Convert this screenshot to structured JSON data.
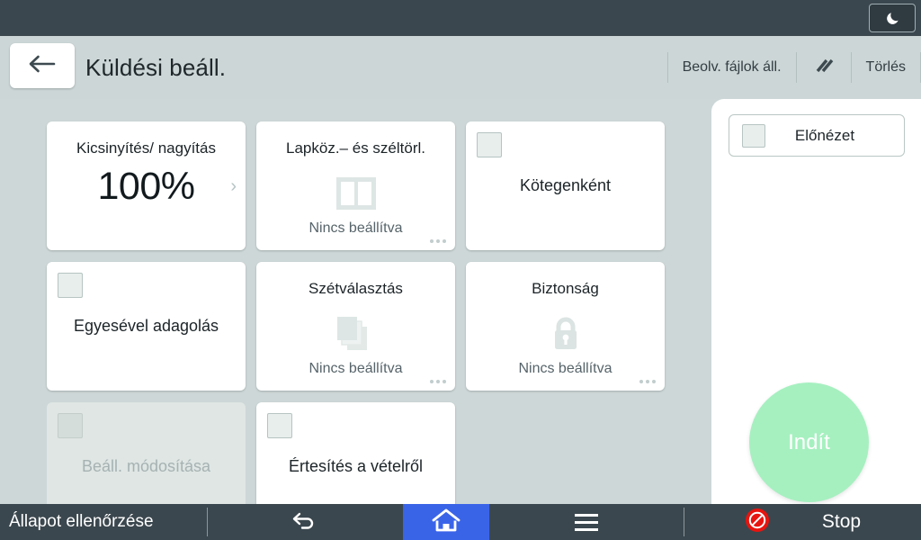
{
  "topbar": {
    "night_mode_icon": "moon-icon"
  },
  "header": {
    "back_icon": "arrow-left-icon",
    "title": "Küldési beáll.",
    "scanned_files_label": "Beolv. fájlok áll.",
    "slash_icon": "double-slash-icon",
    "clear_label": "Törlés"
  },
  "cards": [
    {
      "id": "reduce-enlarge",
      "title": "Kicsinyítés/ nagyítás",
      "value": "100%",
      "chevron": "chevron-right-icon",
      "has_checkbox": false,
      "disabled": false
    },
    {
      "id": "margin-erase",
      "title": "Lapköz.– és széltörl.",
      "status": "Nincs beállítva",
      "icon": "two-pane-icon",
      "has_dots": true,
      "has_checkbox": false,
      "disabled": false
    },
    {
      "id": "batch",
      "center_label": "Kötegenként",
      "has_checkbox": true,
      "disabled": false
    },
    {
      "id": "sadf",
      "center_label": "Egyesével adagolás",
      "has_checkbox": true,
      "disabled": false
    },
    {
      "id": "divide",
      "title": "Szétválasztás",
      "status": "Nincs beállítva",
      "icon": "stacked-pages-icon",
      "has_dots": true,
      "has_checkbox": false,
      "disabled": false
    },
    {
      "id": "security",
      "title": "Biztonság",
      "status": "Nincs beállítva",
      "icon": "lock-icon",
      "has_dots": true,
      "has_checkbox": false,
      "disabled": false
    },
    {
      "id": "change-settings",
      "center_label": "Beáll. módosítása",
      "has_checkbox": true,
      "disabled": true
    },
    {
      "id": "reception-notice",
      "center_label": "Értesítés a vételről",
      "has_checkbox": true,
      "disabled": false
    }
  ],
  "right_panel": {
    "preview_label": "Előnézet",
    "start_label": "Indít",
    "start_color": "#a6f0c0"
  },
  "bottombar": {
    "status_label": "Állapot ellenőrzése",
    "back_icon": "back-arrow-icon",
    "home_icon": "home-icon",
    "menu_icon": "hamburger-menu-icon",
    "stop_icon": "stop-icon",
    "stop_label": "Stop",
    "home_accent": "#3a64e8",
    "stop_accent": "#e8140f"
  }
}
